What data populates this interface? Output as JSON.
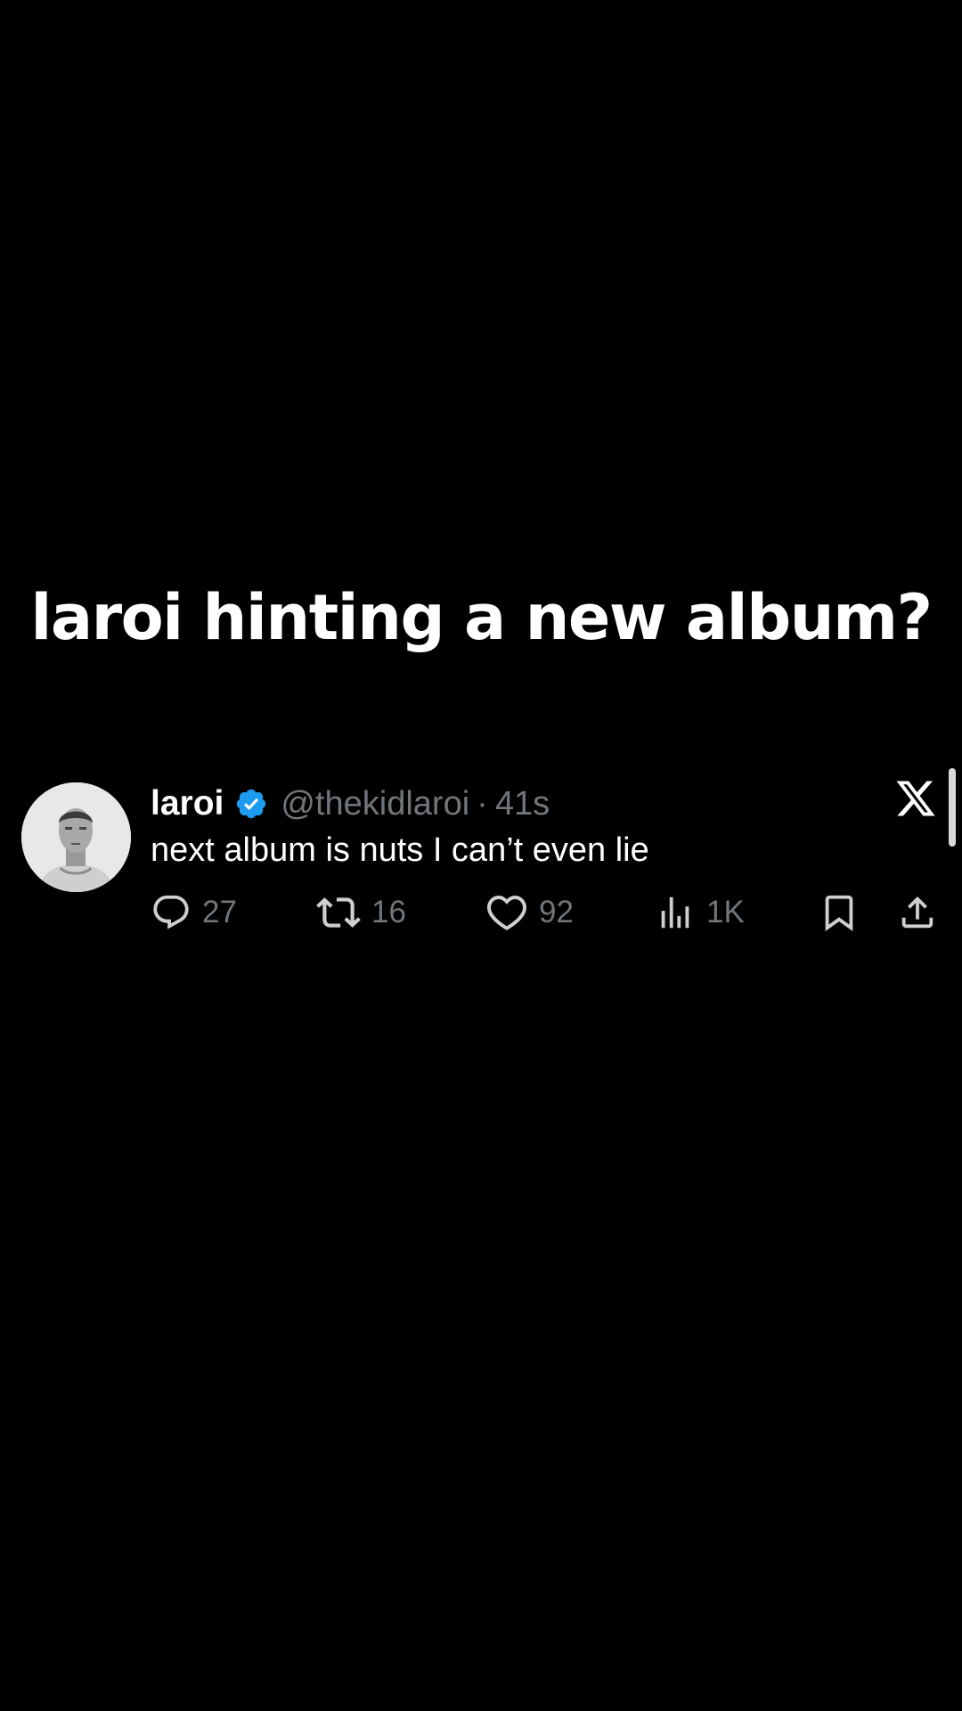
{
  "caption": "laroi hinting a new album?",
  "tweet": {
    "display_name": "laroi",
    "handle": "@thekidlaroi",
    "separator": "·",
    "time": "41s",
    "text": "next album is nuts I can’t even lie",
    "verified": true,
    "verified_color": "#1d9bf0",
    "avatar_icon": "profile-photo",
    "logo_icon": "x-logo-icon",
    "actions": {
      "replies": "27",
      "reposts": "16",
      "likes": "92",
      "views": "1K"
    }
  },
  "colors": {
    "background": "#000000",
    "text": "#ffffff",
    "muted": "#71767b"
  }
}
